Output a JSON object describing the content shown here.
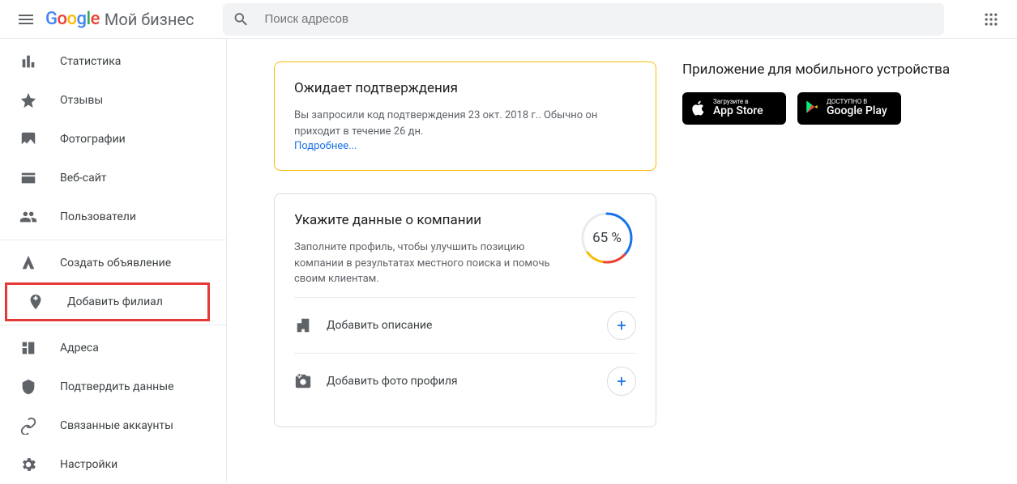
{
  "header": {
    "product": "Мой бизнес",
    "search_placeholder": "Поиск адресов"
  },
  "sidebar": {
    "items": [
      {
        "key": "stats",
        "label": "Статистика"
      },
      {
        "key": "reviews",
        "label": "Отзывы"
      },
      {
        "key": "photos",
        "label": "Фотографии"
      },
      {
        "key": "website",
        "label": "Веб-сайт"
      },
      {
        "key": "users",
        "label": "Пользователи"
      }
    ],
    "promo_items": [
      {
        "key": "create-ad",
        "label": "Создать объявление"
      },
      {
        "key": "add-branch",
        "label": "Добавить филиал",
        "highlighted": true
      }
    ],
    "admin_items": [
      {
        "key": "addresses",
        "label": "Адреса"
      },
      {
        "key": "verify",
        "label": "Подтвердить данные"
      },
      {
        "key": "linked",
        "label": "Связанные аккаунты"
      },
      {
        "key": "settings",
        "label": "Настройки"
      }
    ]
  },
  "verify_card": {
    "title": "Ожидает подтверждения",
    "body": "Вы запросили код подтверждения 23 окт. 2018 г.. Обычно он приходит в течение 26 дн.",
    "link": "Подробнее..."
  },
  "profile_card": {
    "title": "Укажите данные о компании",
    "body": "Заполните профиль, чтобы улучшить позицию компании в результатах местного поиска и помочь своим клиентам.",
    "percent_label": "65 %",
    "percent_value": 65,
    "actions": [
      {
        "key": "add-description",
        "label": "Добавить описание"
      },
      {
        "key": "add-photo",
        "label": "Добавить фото профиля"
      }
    ]
  },
  "mobile_card": {
    "title": "Приложение для мобильного устройства",
    "appstore": {
      "top": "Загрузите в",
      "bottom": "App Store"
    },
    "gplay": {
      "top": "ДОСТУПНО В",
      "bottom": "Google Play"
    }
  }
}
